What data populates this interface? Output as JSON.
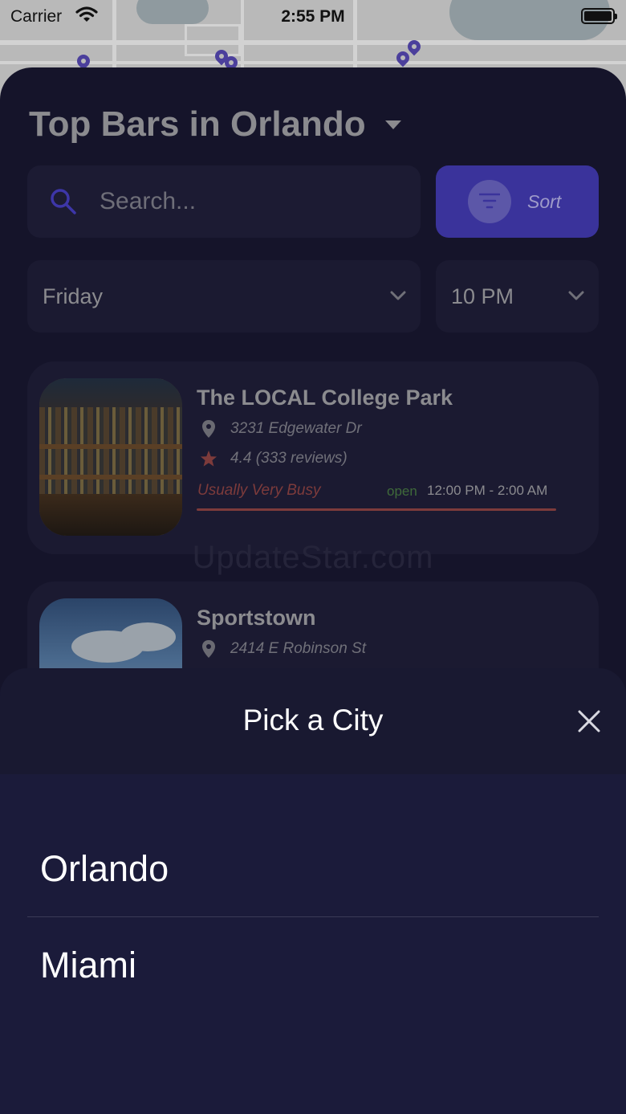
{
  "status_bar": {
    "carrier": "Carrier",
    "time": "2:55 PM"
  },
  "header": {
    "title": "Top Bars in Orlando"
  },
  "search": {
    "placeholder": "Search..."
  },
  "sort": {
    "label": "Sort"
  },
  "filters": {
    "day": "Friday",
    "time": "10 PM"
  },
  "bars": [
    {
      "name": "The LOCAL College Park",
      "address": "3231 Edgewater Dr",
      "rating": "4.4 (333 reviews)",
      "busyness": "Usually Very Busy",
      "open_status": "open",
      "hours": "12:00 PM - 2:00 AM"
    },
    {
      "name": "Sportstown",
      "address": "2414 E Robinson St"
    }
  ],
  "watermark": "UpdateStar.com",
  "city_picker": {
    "title": "Pick a City",
    "cities": [
      "Orlando",
      "Miami"
    ]
  },
  "colors": {
    "accent": "#3a339b",
    "busy": "#7d3b3b",
    "open": "#3f6a3a",
    "sheet_background": "#15142a",
    "picker_background": "#1b1b3a"
  },
  "icons": [
    "wifi-icon",
    "battery-icon",
    "search-icon",
    "filter-icon",
    "chevron-down-icon",
    "location-pin-icon",
    "star-icon",
    "close-icon",
    "caret-down-icon"
  ]
}
